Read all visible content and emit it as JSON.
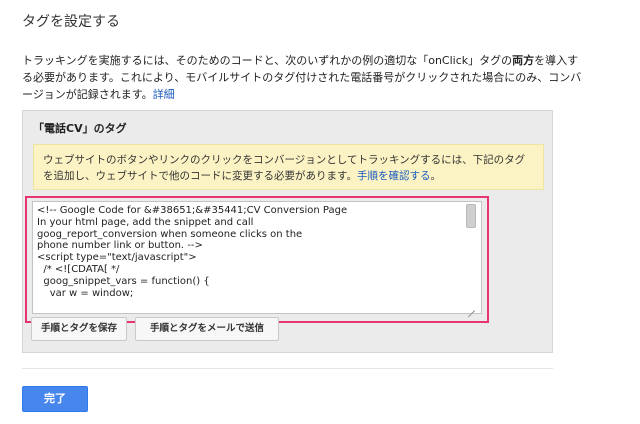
{
  "page": {
    "title": "タグを設定する"
  },
  "intro": {
    "part1": "トラッキングを実施するには、そのためのコードと、次のいずれかの例の適切な「onClick」タグの",
    "bold": "両方",
    "part2": "を導入する必要があります。これにより、モバイルサイトのタグ付けされた電話番号がクリックされた場合にのみ、コンバージョンが記録されます。",
    "details_link": "詳細"
  },
  "panel": {
    "title": "「電話CV」のタグ",
    "notice_text": "ウェブサイトのボタンやリンクのクリックをコンバージョンとしてトラッキングするには、下記のタグを追加し、ウェブサイトで他のコードに変更する必要があります。",
    "notice_link": "手順を確認する",
    "notice_end": "。",
    "code": "<!-- Google Code for &#38651;&#35441;CV Conversion Page\nIn your html page, add the snippet and call\ngoog_report_conversion when someone clicks on the\nphone number link or button. -->\n<script type=\"text/javascript\">\n  /* <![CDATA[ */\n  goog_snippet_vars = function() {\n    var w = window;",
    "save_button": "手順とタグを保存",
    "email_button": "手順とタグをメールで送信"
  },
  "footer": {
    "done_button": "完了"
  },
  "colors": {
    "accent": "#4787ed",
    "link": "#1a5bbf",
    "highlight_border": "#e8356f",
    "notice_bg": "#fbf3c4"
  }
}
